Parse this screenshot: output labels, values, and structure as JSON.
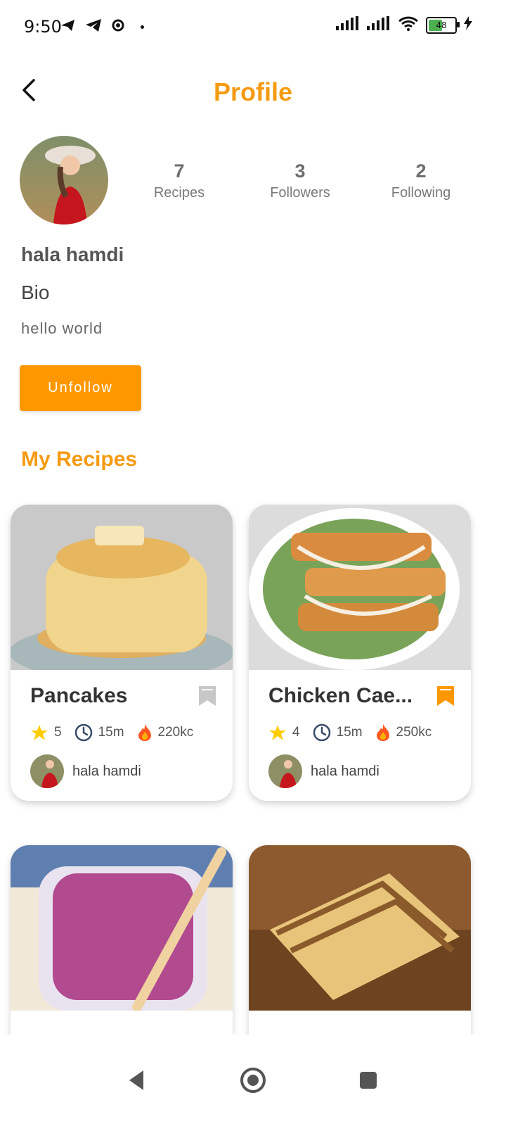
{
  "status": {
    "time": "9:50",
    "battery": "48"
  },
  "header": {
    "title": "Profile"
  },
  "profile": {
    "name": "hala hamdi",
    "bio_label": "Bio",
    "bio": "hello world",
    "stats": [
      {
        "number": "7",
        "label": "Recipes"
      },
      {
        "number": "3",
        "label": "Followers"
      },
      {
        "number": "2",
        "label": "Following"
      }
    ],
    "action_label": "Unfollow"
  },
  "section": {
    "title": "My Recipes"
  },
  "recipes": [
    {
      "title": "Pancakes",
      "rating": "5",
      "time": "15m",
      "calories": "220kc",
      "author": "hala hamdi",
      "bookmarked": false
    },
    {
      "title": "Chicken Cae...",
      "rating": "4",
      "time": "15m",
      "calories": "250kc",
      "author": "hala hamdi",
      "bookmarked": true
    }
  ],
  "colors": {
    "accent": "#ff9800",
    "title": "#f59b12"
  },
  "icons": {
    "back": "back-arrow-icon",
    "star": "star-icon",
    "clock": "clock-icon",
    "fire": "fire-icon",
    "bookmark": "bookmark-icon"
  }
}
